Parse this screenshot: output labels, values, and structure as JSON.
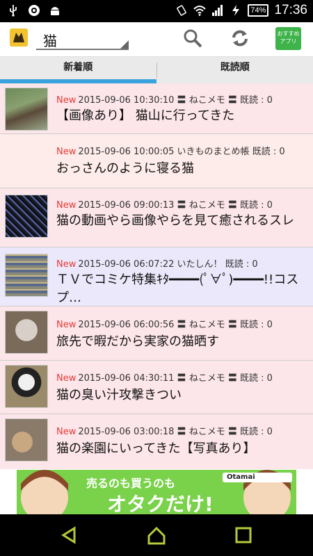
{
  "status_bar": {
    "time": "17:36",
    "battery": "74%"
  },
  "app_bar": {
    "spinner_value": "猫",
    "recommend_label_line1": "おすすめ",
    "recommend_label_line2": "アプリ"
  },
  "tabs": [
    {
      "label": "新着順",
      "active": true
    },
    {
      "label": "既読順",
      "active": false
    }
  ],
  "items": [
    {
      "new_label": "New",
      "meta": "2015-09-06 10:30:10 〓 ねこメモ 〓 既読 : 0",
      "title": "【画像あり】 猫山に行ってきた",
      "bg": "#fde6ea"
    },
    {
      "new_label": "New",
      "meta": "2015-09-06 10:00:05 いきものまとめ帳 既読 : 0",
      "title": "おっさんのように寝る猫",
      "bg": "#fdecea"
    },
    {
      "new_label": "New",
      "meta": "2015-09-06 09:00:13 〓 ねこメモ 〓 既読 : 0",
      "title": "猫の動画やら画像やらを見て癒されるスレ",
      "bg": "#fde6ea"
    },
    {
      "new_label": "New",
      "meta": "2015-09-06 06:07:22 いたしん！ 既読 : 0",
      "title": "ＴＶでコミケ特集ｷﾀ━━━━(ﾟ∀ﾟ)━━━━!!コスプ…",
      "bg": "#ece8fb"
    },
    {
      "new_label": "New",
      "meta": "2015-09-06 06:00:56 〓 ねこメモ 〓 既読 : 0",
      "title": "旅先で暇だから実家の猫晒す",
      "bg": "#fde6ea"
    },
    {
      "new_label": "New",
      "meta": "2015-09-06 04:30:11 〓 ねこメモ 〓 既読 : 0",
      "title": "猫の臭い汁攻撃きつい",
      "bg": "#fde6ea"
    },
    {
      "new_label": "New",
      "meta": "2015-09-06 03:00:18 〓 ねこメモ 〓 既読 : 0",
      "title": "猫の楽園にいってきた【写真あり】",
      "bg": "#fde6ea"
    }
  ],
  "ad": {
    "text_small": "売るのも買うのも",
    "text_big": "オタクだけ!",
    "brand": "Otamai"
  },
  "colors": {
    "accent": "#3aa3dd",
    "new_label": "#e53935",
    "recommend_green": "#3db34a",
    "item_pink": "#fde6ea",
    "item_lavender": "#ece8fb"
  }
}
